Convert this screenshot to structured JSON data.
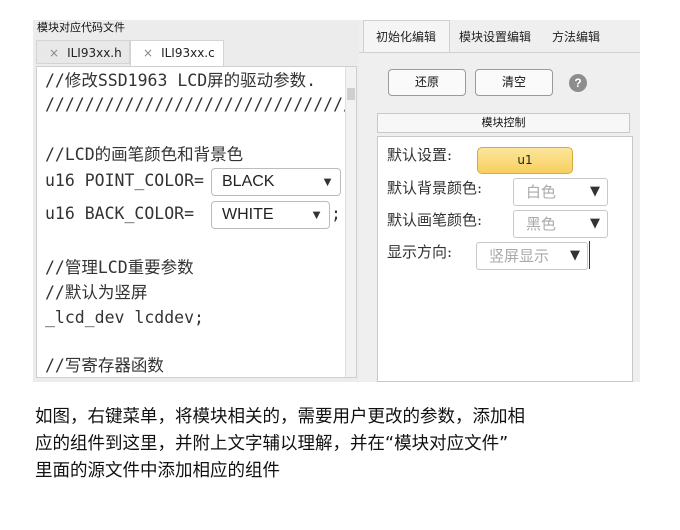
{
  "left": {
    "title": "模块对应代码文件",
    "tabs": [
      {
        "close": "×",
        "label": "ILI93xx.h"
      },
      {
        "close": "×",
        "label": "ILI93xx.c"
      }
    ],
    "code": {
      "line1": "//修改SSD1963 LCD屏的驱动参数.",
      "line2": "////////////////////////////////",
      "line3": "//LCD的画笔颜色和背景色",
      "point_prefix": "u16 POINT_COLOR=",
      "point_value": "BLACK",
      "back_prefix": "u16 BACK_COLOR=",
      "back_value": "WHITE",
      "semicolon": ";",
      "line6": "//管理LCD重要参数",
      "line7": "//默认为竖屏",
      "line8": "_lcd_dev lcddev;",
      "line9": "//写寄存器函数"
    },
    "dropdown_arrow": "▼"
  },
  "right": {
    "tabs": [
      "初始化编辑",
      "模块设置编辑",
      "方法编辑"
    ],
    "buttons": {
      "restore": "还原",
      "clear": "清空"
    },
    "help": "?",
    "group_title": "模块控制",
    "props": [
      {
        "label": "默认设置:",
        "value": "u1"
      },
      {
        "label": "默认背景颜色:",
        "value": "白色"
      },
      {
        "label": "默认画笔颜色:",
        "value": "黑色"
      },
      {
        "label": "显示方向:",
        "value": "竖屏显示"
      }
    ],
    "dropdown_arrow": "▼"
  },
  "caption": [
    "如图，右键菜单，将模块相关的，需要用户更改的参数，添加相",
    "应的组件到这里，并附上文字辅以理解，并在“模块对应文件”",
    "里面的源文件中添加相应的组件"
  ]
}
